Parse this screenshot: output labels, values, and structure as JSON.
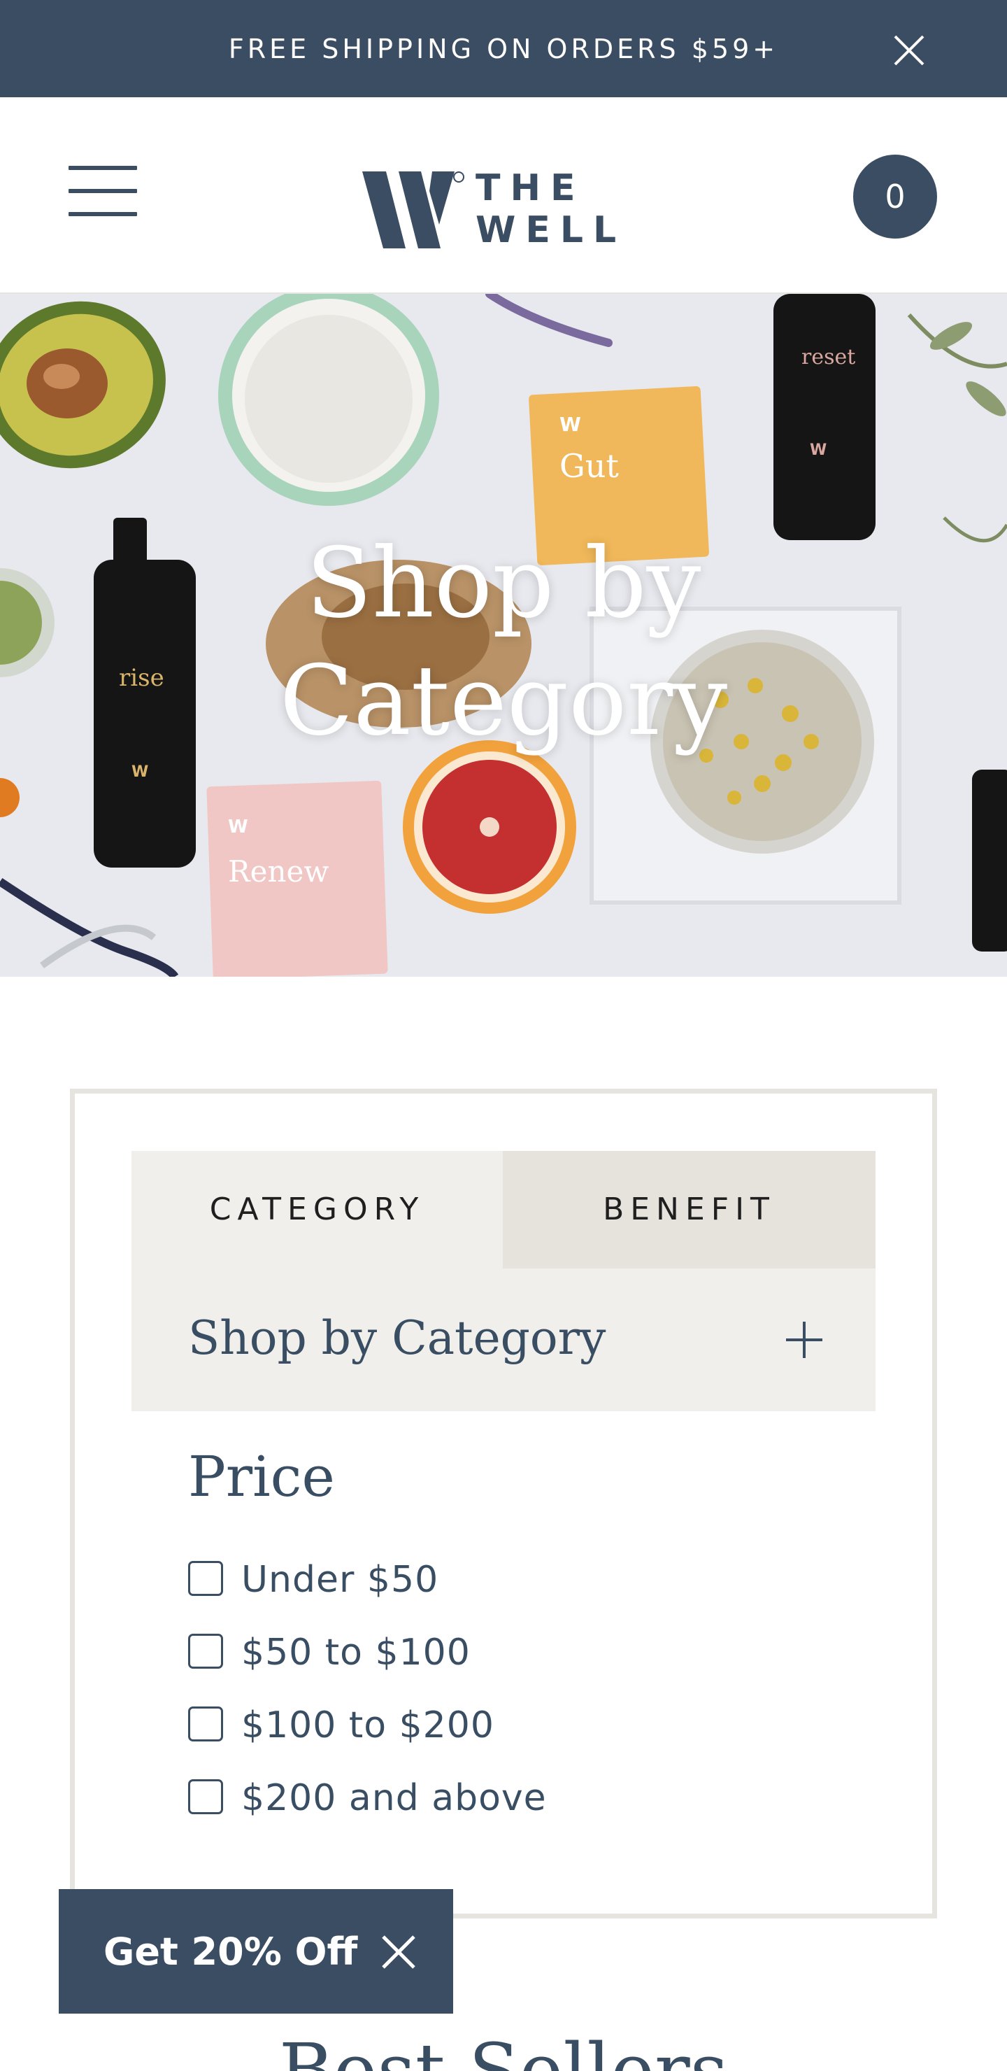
{
  "announcement": {
    "text": "FREE SHIPPING ON ORDERS $59+",
    "close_icon": "close-icon"
  },
  "header": {
    "menu_icon": "hamburger-menu-icon",
    "logo": {
      "line1": "THE",
      "line2": "WELL"
    },
    "cart_count": "0"
  },
  "hero": {
    "title_line1": "Shop by",
    "title_line2": "Category",
    "product_labels": [
      "rise",
      "reset",
      "Gut",
      "Renew"
    ]
  },
  "filters": {
    "tabs": [
      {
        "label": "CATEGORY",
        "active": true
      },
      {
        "label": "BENEFIT",
        "active": false
      }
    ],
    "accordion": {
      "label": "Shop by Category",
      "icon": "plus-icon"
    },
    "price": {
      "heading": "Price",
      "options": [
        {
          "label": "Under $50",
          "checked": false
        },
        {
          "label": "$50 to $100",
          "checked": false
        },
        {
          "label": "$100 to $200",
          "checked": false
        },
        {
          "label": "$200 and above",
          "checked": false
        }
      ]
    }
  },
  "best_sellers": {
    "heading": "Best Sellers"
  },
  "popup": {
    "label": "Get 20% Off",
    "close_icon": "close-icon"
  },
  "colors": {
    "navy": "#3b4d63",
    "beige": "#f0efeb",
    "beige_dark": "#e6e3dd",
    "border": "#e6e4df"
  }
}
